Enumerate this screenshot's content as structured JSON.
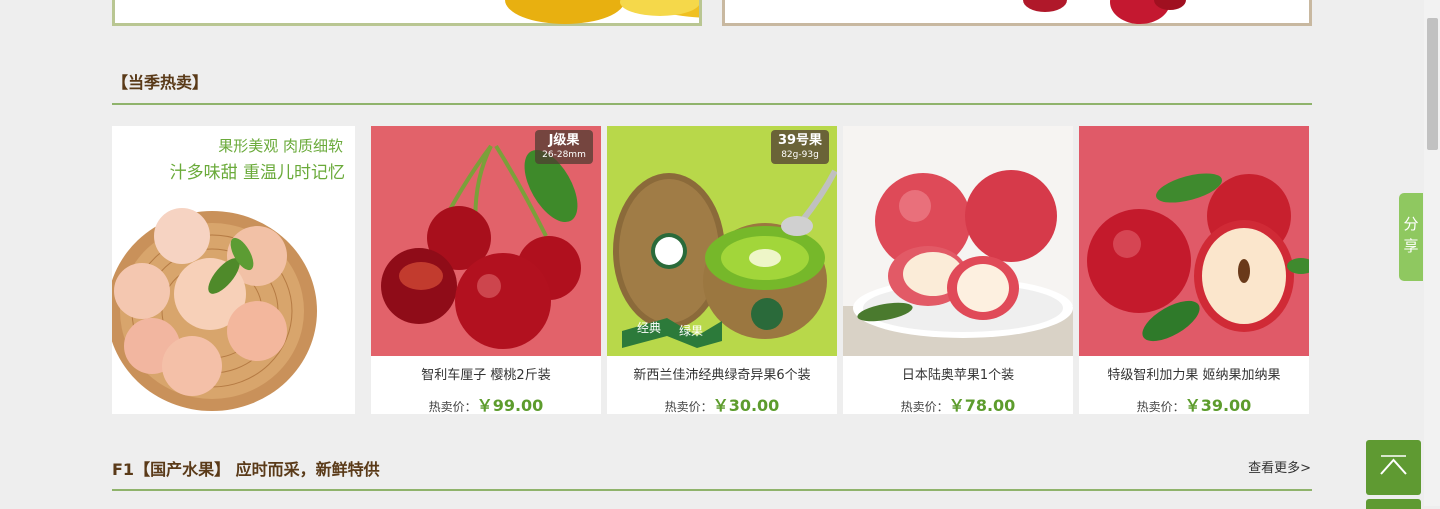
{
  "hot_section": {
    "title": "【当季热卖】"
  },
  "promo": {
    "line1": "果形美观 肉质细软",
    "line2": "汁多味甜 重温儿时记忆"
  },
  "products": [
    {
      "name": "智利车厘子 樱桃2斤装",
      "price_label": "热卖价：",
      "price": "￥99.00",
      "badge_main": "J级果",
      "badge_sub": "26-28mm"
    },
    {
      "name": "新西兰佳沛经典绿奇异果6个装",
      "price_label": "热卖价：",
      "price": "￥30.00",
      "badge_main": "39号果",
      "badge_sub": "82g-93g",
      "tag_left": "经典",
      "tag_right": "绿果"
    },
    {
      "name": "日本陆奥苹果1个装",
      "price_label": "热卖价：",
      "price": "￥78.00"
    },
    {
      "name": "特级智利加力果 姬纳果加纳果",
      "price_label": "热卖价：",
      "price": "￥39.00"
    }
  ],
  "f1_section": {
    "title": "F1【国产水果】 应时而采，新鲜特供",
    "more": "查看更多>"
  },
  "share": {
    "label": "分享"
  },
  "colors": {
    "accent": "#5d9c2d",
    "title": "#5a3a18",
    "rule": "#8fb36b"
  },
  "icons": {
    "to_top": "arrow-up-icon"
  }
}
